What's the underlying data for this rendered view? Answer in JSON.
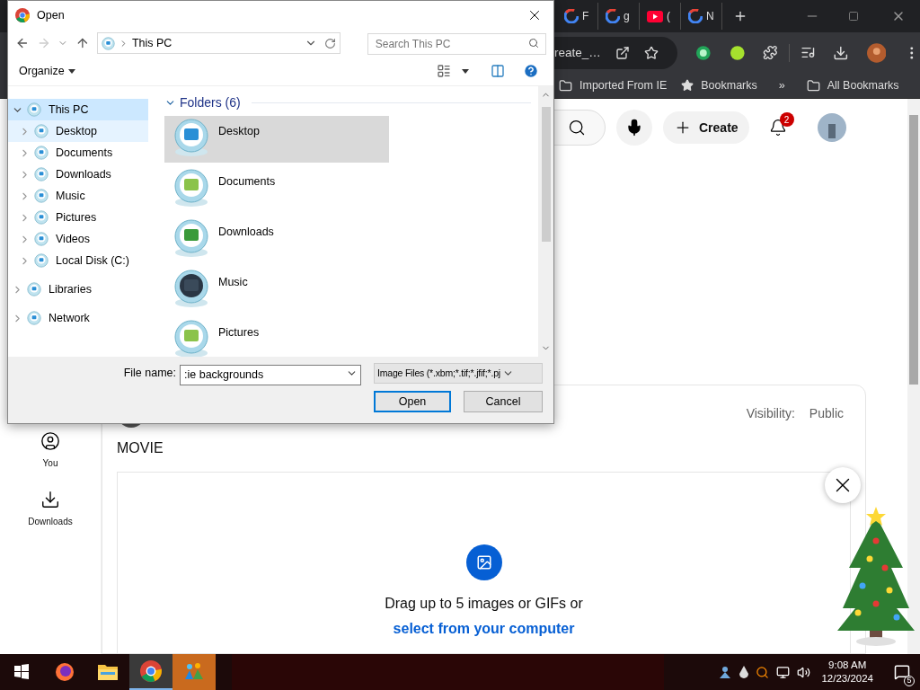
{
  "browser": {
    "tabs": [
      {
        "title": "F",
        "kind": "google"
      },
      {
        "title": "g",
        "kind": "google"
      },
      {
        "title": "(",
        "kind": "youtube"
      },
      {
        "title": "N",
        "kind": "google"
      }
    ],
    "omnibox": {
      "text": "reate_…"
    },
    "bookmarks": [
      {
        "label": "Imported From IE",
        "kind": "folder"
      },
      {
        "label": "Bookmarks",
        "kind": "star"
      },
      {
        "label": "»",
        "kind": "more"
      },
      {
        "label": "All Bookmarks",
        "kind": "folder"
      }
    ]
  },
  "page": {
    "header": {
      "create_label": "Create",
      "notification_count": "2"
    },
    "sidebar": [
      {
        "label": "You",
        "kind": "you"
      },
      {
        "label": "Downloads",
        "kind": "downloads"
      }
    ],
    "post": {
      "visibility_label": "Visibility:",
      "visibility_value": "Public",
      "title": "MOVIE",
      "drop_text": "Drag up to 5 images or GIFs or",
      "drop_link": "select from your computer"
    }
  },
  "dialog": {
    "title": "Open",
    "address": "This PC",
    "search_placeholder": "Search This PC",
    "organize": "Organize",
    "tree": [
      {
        "label": "This PC",
        "expanded": true,
        "selected": true,
        "children": [
          {
            "label": "Desktop",
            "expanded": false,
            "selected": false,
            "hovered": true
          },
          {
            "label": "Documents",
            "expanded": false,
            "selected": false,
            "hovered": false
          },
          {
            "label": "Downloads",
            "expanded": false,
            "selected": false,
            "hovered": false
          },
          {
            "label": "Music",
            "expanded": false,
            "selected": false,
            "hovered": false
          },
          {
            "label": "Pictures",
            "expanded": false,
            "selected": false,
            "hovered": false
          },
          {
            "label": "Videos",
            "expanded": false,
            "selected": false,
            "hovered": false
          },
          {
            "label": "Local Disk (C:)",
            "expanded": false,
            "selected": false,
            "hovered": false
          }
        ]
      },
      {
        "label": "Libraries",
        "expanded": false,
        "selected": false,
        "hovered": false
      },
      {
        "label": "Network",
        "expanded": false,
        "selected": false,
        "hovered": false
      }
    ],
    "group": {
      "title": "Folders (6)",
      "expanded": true
    },
    "folders": [
      {
        "label": "Desktop",
        "selected": true
      },
      {
        "label": "Documents",
        "selected": false
      },
      {
        "label": "Downloads",
        "selected": false
      },
      {
        "label": "Music",
        "selected": false
      },
      {
        "label": "Pictures",
        "selected": false
      }
    ],
    "file_name_label": "File name:",
    "file_name": ":ie backgrounds",
    "file_type": "Image Files (*.xbm;*.tif;*.jfif;*.pj",
    "open_button": "Open",
    "cancel_button": "Cancel"
  },
  "taskbar": {
    "apps": [
      {
        "kind": "firefox",
        "active": false
      },
      {
        "kind": "explorer",
        "active": false
      },
      {
        "kind": "chrome",
        "active": true
      },
      {
        "kind": "app",
        "active": false
      }
    ],
    "time": "9:08 AM",
    "date": "12/23/2024",
    "notifications": "5"
  }
}
